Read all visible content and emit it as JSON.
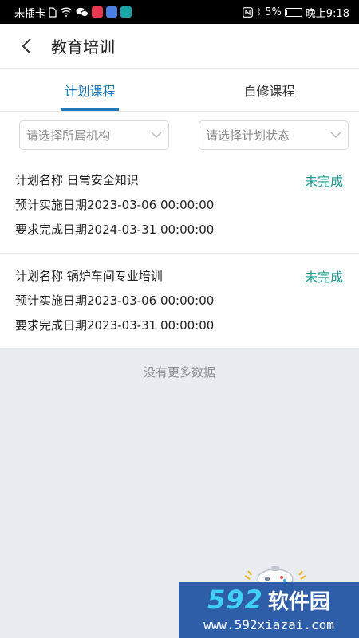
{
  "status_bar": {
    "carrier": "未插卡",
    "battery_text": "5%",
    "battery_level_percent": 5,
    "time": "晚上9:18"
  },
  "header": {
    "title": "教育培训"
  },
  "tabs": [
    {
      "label": "计划课程",
      "active": true
    },
    {
      "label": "自修课程",
      "active": false
    }
  ],
  "filters": {
    "org_placeholder": "请选择所属机构",
    "status_placeholder": "请选择计划状态"
  },
  "plans": [
    {
      "name": "计划名称 日常安全知识",
      "status": "未完成",
      "plan_date": "预计实施日期2023-03-06 00:00:00",
      "due_date": "要求完成日期2024-03-31 00:00:00"
    },
    {
      "name": "计划名称 锅炉车间专业培训",
      "status": "未完成",
      "plan_date": "预计实施日期2023-03-06 00:00:00",
      "due_date": "要求完成日期2023-03-31 00:00:00"
    }
  ],
  "footer": {
    "no_more": "没有更多数据"
  },
  "watermark": {
    "number": "592",
    "brand": "软件园",
    "url": "www.592xiazai.com"
  },
  "colors": {
    "accent": "#1c7ab8",
    "status_incomplete": "#1d9a8e",
    "background": "#e9edf1"
  }
}
